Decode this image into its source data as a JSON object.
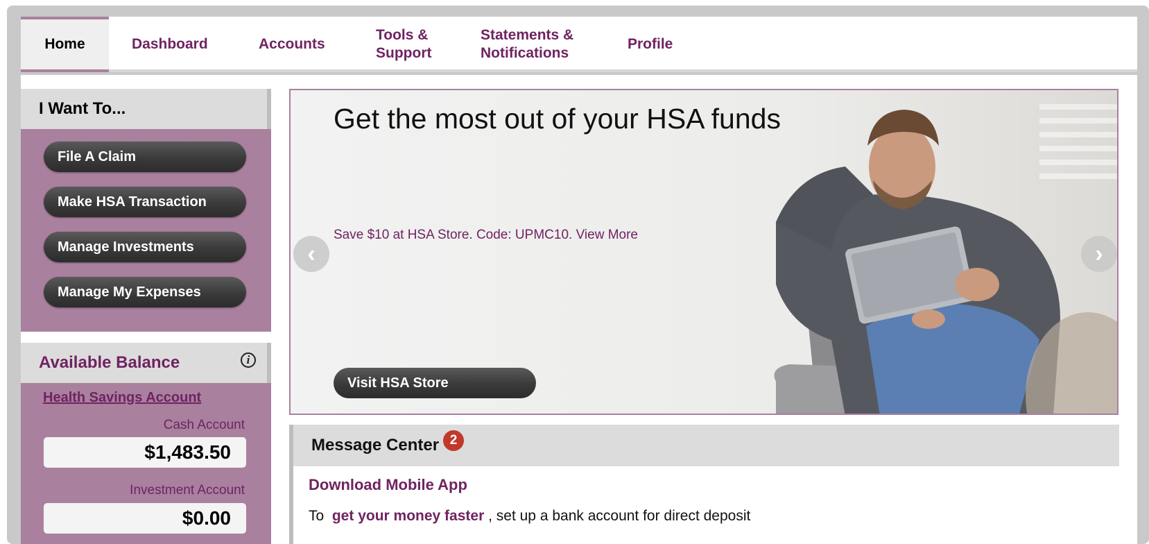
{
  "nav": {
    "tabs": [
      {
        "label": "Home",
        "active": true
      },
      {
        "label": "Dashboard"
      },
      {
        "label": "Accounts"
      },
      {
        "label": "Tools & Support"
      },
      {
        "label": "Statements & Notifications"
      },
      {
        "label": "Profile"
      }
    ]
  },
  "sidebar": {
    "want_title": "I Want To...",
    "actions": [
      "File A Claim",
      "Make HSA Transaction",
      "Manage Investments",
      "Manage My Expenses"
    ],
    "balance_title": "Available Balance",
    "balance_info_icon": "info-icon",
    "account_link": "Health Savings Account",
    "cash_label": "Cash Account",
    "cash_value": "$1,483.50",
    "investment_label": "Investment Account",
    "investment_value": "$0.00"
  },
  "banner": {
    "title": "Get the most out of your HSA funds",
    "promo": "Save $10 at HSA Store. Code: UPMC10. View More",
    "button": "Visit HSA Store",
    "prev_icon": "chevron-left-icon",
    "next_icon": "chevron-right-icon"
  },
  "messages": {
    "title": "Message Center",
    "badge_count": "2",
    "download": "Download Mobile App",
    "line_prefix": "To",
    "line_link": "get your money faster",
    "line_suffix": ", set up a bank account for direct deposit"
  },
  "colors": {
    "brand": "#6f2361",
    "panel": "#a9809e",
    "badge": "#c0392b"
  }
}
